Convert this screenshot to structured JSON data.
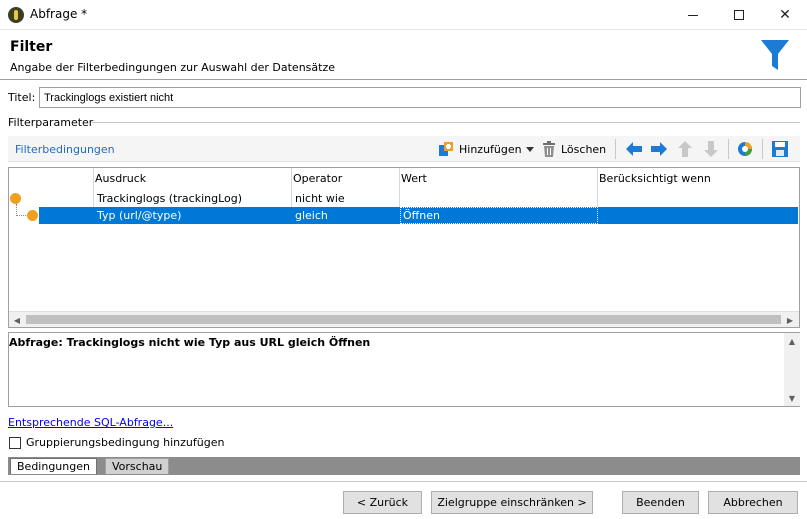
{
  "window": {
    "title": "Abfrage *",
    "min_glyph": "",
    "close_glyph": "✕"
  },
  "header": {
    "title": "Filter",
    "subtitle": "Angabe der Filterbedingungen zur Auswahl der Datensätze",
    "icon": "funnel-icon",
    "icon_color": "#1c7cd5"
  },
  "title_field": {
    "label": "Titel:",
    "value": "Trackinglogs existiert nicht"
  },
  "filter_params": {
    "legend": "Filterparameter",
    "toolbar": {
      "label": "Filterbedingungen",
      "add_label": "Hinzufügen",
      "delete_label": "Löschen",
      "icons": [
        "add-icon",
        "dropdown-arrow-icon",
        "trash-icon",
        "arrow-left-icon",
        "arrow-right-icon",
        "arrow-up-icon",
        "arrow-down-icon",
        "distribution-icon",
        "save-icon"
      ]
    },
    "columns": [
      "Ausdruck",
      "Operator",
      "Wert",
      "Berücksichtigt wenn"
    ],
    "rows": [
      {
        "expression": "Trackinglogs (trackingLog)",
        "operator": "nicht wie",
        "value": "",
        "condition": ""
      },
      {
        "expression": "Typ (url/@type)",
        "operator": "gleich",
        "value": "Öffnen",
        "condition": ""
      }
    ],
    "dot_color": "#f0a020",
    "selection_color": "#0078d7"
  },
  "description": {
    "text": "Abfrage: Trackinglogs nicht wie Typ aus URL gleich Öffnen"
  },
  "sql_link": "Entsprechende SQL-Abfrage...",
  "group_option": {
    "label": "Gruppierungsbedingung hinzufügen",
    "checked": false
  },
  "tabs": [
    "Bedingungen",
    "Vorschau"
  ],
  "footer": {
    "back": "< Zurück",
    "target": "Zielgruppe einschränken >",
    "finish": "Beenden",
    "cancel": "Abbrechen"
  }
}
